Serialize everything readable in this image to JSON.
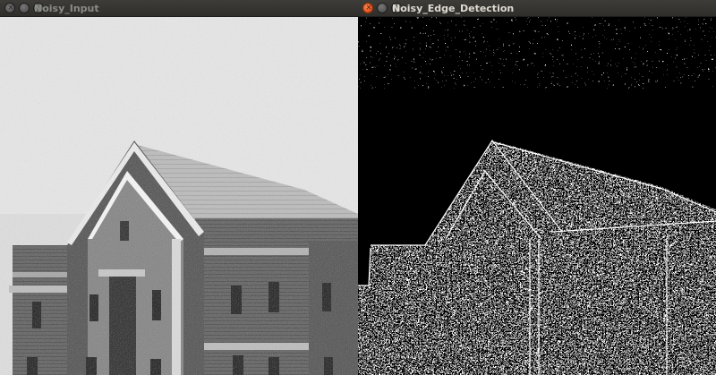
{
  "windows": {
    "left": {
      "title": "Noisy_Input",
      "active": false
    },
    "right": {
      "title": "Noisy_Edge_Detection",
      "active": true
    }
  },
  "icons": {
    "close": "close-icon",
    "minimize": "minimize-icon",
    "maximize": "maximize-icon"
  },
  "colors": {
    "titlebar": "#33322e",
    "close_active": "#e0531f",
    "button_inactive": "#5a5a5a",
    "edge_background": "#000000",
    "edge_lines": "#ffffff",
    "sky": "#e6e6e6",
    "roof": "#b9b9b9",
    "brick": "#666666"
  }
}
